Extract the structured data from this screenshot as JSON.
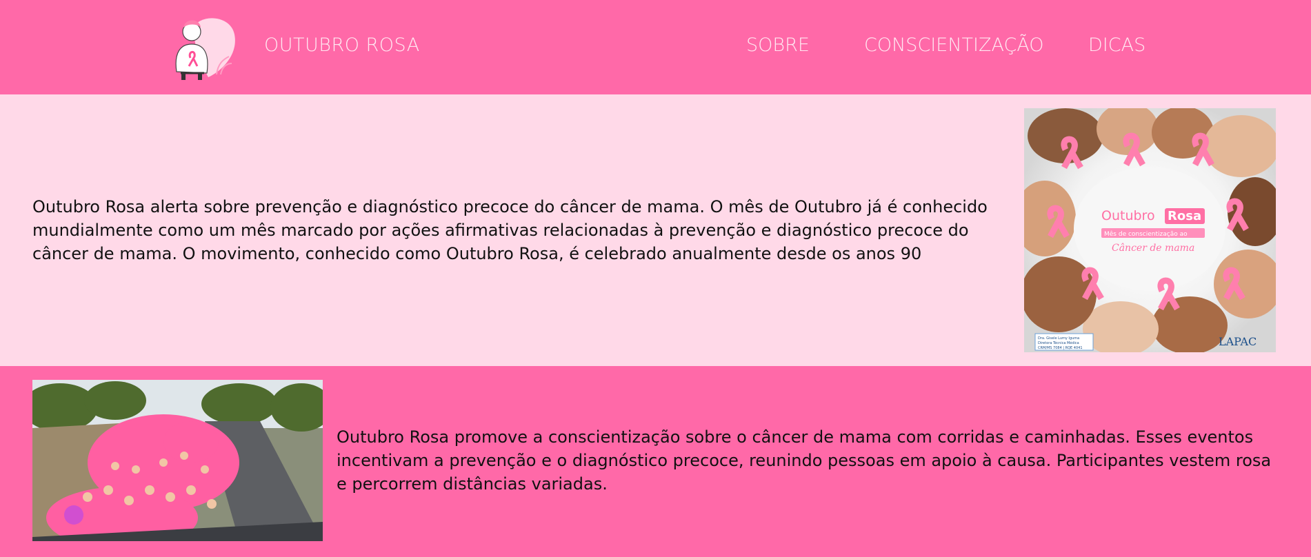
{
  "header": {
    "brand": "OUTUBRO ROSA",
    "logo_icon": "person-with-pink-ribbon-icon",
    "nav": [
      {
        "label": "SOBRE"
      },
      {
        "label": "CONSCIENTIZAÇÃO"
      },
      {
        "label": "DICAS"
      }
    ]
  },
  "section1": {
    "paragraph": "Outubro Rosa alerta sobre prevenção e diagnóstico precoce do câncer de mama. O mês de Outubro já é conhecido mundialmente como um mês marcado por ações afirmativas relacionadas à prevenção e diagnóstico precoce do câncer de mama. O movimento, conhecido como Outubro Rosa, é celebrado anualmente desde os anos 90",
    "image": {
      "title_line1": "Outubro",
      "title_line2": "Rosa",
      "subtitle": "Mês de conscientização ao",
      "script": "Câncer de mama",
      "badge_line1": "Dra. Gisele Lumy Iguma",
      "badge_line2": "Diretora Técnica Médica",
      "badge_line3": "CRM/MS 7084 | RQE 4041",
      "logo_text": "LAPAC"
    }
  },
  "section2": {
    "paragraph": "Outubro Rosa promove a conscientização sobre o câncer de mama com corridas e caminhadas. Esses eventos incentivam a prevenção e o diagnóstico precoce, reunindo pessoas em apoio à causa. Participantes vestem rosa e percorrem distâncias variadas."
  },
  "colors": {
    "header_bg": "#ff69a8",
    "section1_bg": "#ffd9e8",
    "section2_bg": "#ff69a8",
    "nav_text": "#ffe9f2"
  }
}
